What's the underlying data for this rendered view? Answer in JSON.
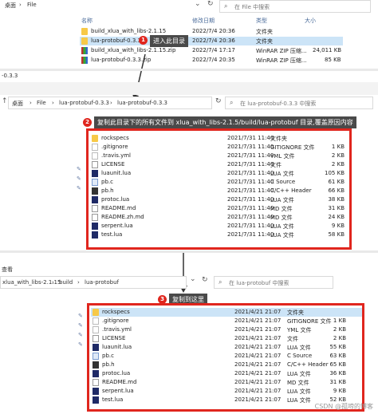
{
  "win1": {
    "sidebar_top": "桌面",
    "breadcrumb": [
      "File"
    ],
    "search_placeholder": "在 File 中搜索",
    "headers": {
      "name": "名称",
      "date": "修改日期",
      "type": "类型",
      "size": "大小"
    },
    "rows": [
      {
        "name": "build_xlua_with_libs-2.1.15",
        "date": "2022/7/4 20:36",
        "type": "文件夹",
        "size": "",
        "icon": "folder"
      },
      {
        "name": "lua-protobuf-0.3.3",
        "date": "2022/7/4 20:36",
        "type": "文件夹",
        "size": "",
        "icon": "folder",
        "selected": true
      },
      {
        "name": "build_xlua_with_libs-2.1.15.zip",
        "date": "2022/7/4 17:17",
        "type": "WinRAR ZIP 压缩...",
        "size": "24,011 KB",
        "icon": "zip"
      },
      {
        "name": "lua-protobuf-0.3.3.zip",
        "date": "2022/7/4 20:35",
        "type": "WinRAR ZIP 压缩...",
        "size": "85 KB",
        "icon": "zip"
      }
    ],
    "callout_num": "1",
    "callout_text": "进入此目录"
  },
  "win2": {
    "title": "-0.3.3",
    "breadcrumb": [
      "桌面",
      "File",
      "lua-protobuf-0.3.3",
      "lua-protobuf-0.3.3"
    ],
    "search_placeholder": "在 lua-protobuf-0.3.3 中搜索",
    "callout_num": "2",
    "callout_text": "复制此目录下的所有文件到 xlua_with_libs-2.1.5/build/lua-protobuf 目录,覆盖原因内容",
    "rows": [
      {
        "name": "rockspecs",
        "date": "2021/7/31 11:40",
        "type": "文件夹",
        "size": "",
        "icon": "folder"
      },
      {
        "name": ".gitignore",
        "date": "2021/7/31 11:40",
        "type": "GITIGNORE 文件",
        "size": "1 KB",
        "icon": "dot"
      },
      {
        "name": ".travis.yml",
        "date": "2021/7/31 11:40",
        "type": "YML 文件",
        "size": "2 KB",
        "icon": "dot"
      },
      {
        "name": "LICENSE",
        "date": "2021/7/31 11:40",
        "type": "文件",
        "size": "2 KB",
        "icon": "gen"
      },
      {
        "name": "luaunit.lua",
        "date": "2021/7/31 11:40",
        "type": "LUA 文件",
        "size": "105 KB",
        "icon": "lua"
      },
      {
        "name": "pb.c",
        "date": "2021/7/31 11:40",
        "type": "C Source",
        "size": "61 KB",
        "icon": "c"
      },
      {
        "name": "pb.h",
        "date": "2021/7/31 11:40",
        "type": "C/C++ Header",
        "size": "66 KB",
        "icon": "hdr-f"
      },
      {
        "name": "protoc.lua",
        "date": "2021/7/31 11:40",
        "type": "LUA 文件",
        "size": "38 KB",
        "icon": "lua"
      },
      {
        "name": "README.md",
        "date": "2021/7/31 11:40",
        "type": "MD 文件",
        "size": "31 KB",
        "icon": "gen"
      },
      {
        "name": "README.zh.md",
        "date": "2021/7/31 11:40",
        "type": "MD 文件",
        "size": "24 KB",
        "icon": "gen"
      },
      {
        "name": "serpent.lua",
        "date": "2021/7/31 11:40",
        "type": "LUA 文件",
        "size": "9 KB",
        "icon": "lua"
      },
      {
        "name": "test.lua",
        "date": "2021/7/31 11:40",
        "type": "LUA 文件",
        "size": "58 KB",
        "icon": "lua"
      }
    ]
  },
  "win3": {
    "sidebar_top": "查看",
    "breadcrumb": [
      "xlua_with_libs-2.1.15",
      "build",
      "lua-protobuf"
    ],
    "search_placeholder": "在 lua-protobuf 中搜索",
    "callout_num": "3",
    "callout_text": "复制到这里",
    "rows": [
      {
        "name": "rockspecs",
        "date": "2021/4/21 21:07",
        "type": "文件夹",
        "size": "",
        "icon": "folder",
        "selected": true
      },
      {
        "name": ".gitignore",
        "date": "2021/4/21 21:07",
        "type": "GITIGNORE 文件",
        "size": "1 KB",
        "icon": "dot"
      },
      {
        "name": ".travis.yml",
        "date": "2021/4/21 21:07",
        "type": "YML 文件",
        "size": "2 KB",
        "icon": "dot"
      },
      {
        "name": "LICENSE",
        "date": "2021/4/21 21:07",
        "type": "文件",
        "size": "2 KB",
        "icon": "gen"
      },
      {
        "name": "luaunit.lua",
        "date": "2021/4/21 21:07",
        "type": "LUA 文件",
        "size": "55 KB",
        "icon": "lua"
      },
      {
        "name": "pb.c",
        "date": "2021/4/21 21:07",
        "type": "C Source",
        "size": "63 KB",
        "icon": "c"
      },
      {
        "name": "pb.h",
        "date": "2021/4/21 21:07",
        "type": "C/C++ Header",
        "size": "65 KB",
        "icon": "hdr-f"
      },
      {
        "name": "protoc.lua",
        "date": "2021/4/21 21:07",
        "type": "LUA 文件",
        "size": "36 KB",
        "icon": "lua"
      },
      {
        "name": "README.md",
        "date": "2021/4/21 21:07",
        "type": "MD 文件",
        "size": "31 KB",
        "icon": "gen"
      },
      {
        "name": "serpent.lua",
        "date": "2021/4/21 21:07",
        "type": "LUA 文件",
        "size": "9 KB",
        "icon": "lua"
      },
      {
        "name": "test.lua",
        "date": "2021/4/21 21:07",
        "type": "LUA 文件",
        "size": "52 KB",
        "icon": "lua"
      }
    ]
  },
  "watermark": "CSDN @孤啼的博客",
  "accent_red": "#e0261e"
}
